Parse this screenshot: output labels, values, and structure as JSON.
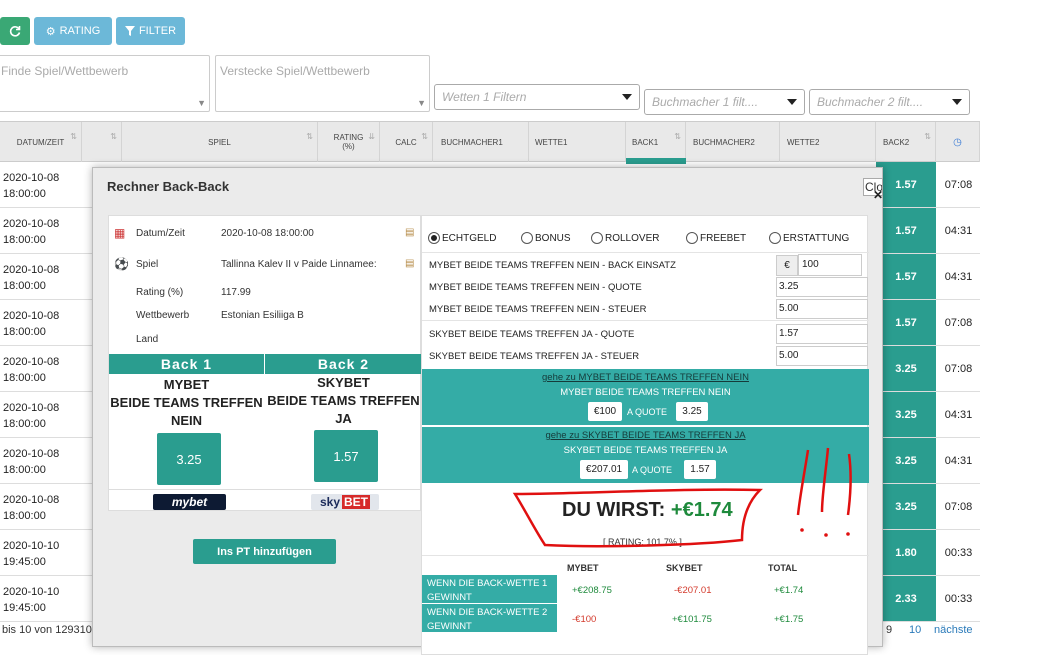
{
  "toolbar": {
    "refresh_icon": "refresh-icon",
    "rating_label": "RATING",
    "filter_label": "FILTER"
  },
  "filters": {
    "search_placeholder": "Finde Spiel/Wettbewerb",
    "hide_placeholder": "Verstecke Spiel/Wettbewerb",
    "wetten_placeholder": "Wetten 1 Filtern",
    "bm1_placeholder": "Buchmacher 1 filt....",
    "bm2_placeholder": "Buchmacher 2 filt...."
  },
  "table": {
    "headers": [
      "DATUM/ZEIT",
      "",
      "SPIEL",
      "RATING (%)",
      "CALC",
      "BUCHMACHER1",
      "WETTE1",
      "BACK1",
      "BUCHMACHER2",
      "WETTE2",
      "BACK2"
    ],
    "rows": [
      {
        "date": "2020-10-08",
        "time": "18:00:00",
        "back2": "1.57",
        "clock": "07:08"
      },
      {
        "date": "2020-10-08",
        "time": "18:00:00",
        "back2": "1.57",
        "clock": "04:31"
      },
      {
        "date": "2020-10-08",
        "time": "18:00:00",
        "back2": "1.57",
        "clock": "04:31"
      },
      {
        "date": "2020-10-08",
        "time": "18:00:00",
        "back2": "1.57",
        "clock": "07:08"
      },
      {
        "date": "2020-10-08",
        "time": "18:00:00",
        "back2": "3.25",
        "clock": "07:08"
      },
      {
        "date": "2020-10-08",
        "time": "18:00:00",
        "back2": "3.25",
        "clock": "04:31"
      },
      {
        "date": "2020-10-08",
        "time": "18:00:00",
        "back2": "3.25",
        "clock": "04:31"
      },
      {
        "date": "2020-10-08",
        "time": "18:00:00",
        "back2": "3.25",
        "clock": "07:08"
      },
      {
        "date": "2020-10-10",
        "time": "19:45:00",
        "back2": "1.80",
        "clock": "00:33"
      },
      {
        "date": "2020-10-10",
        "time": "19:45:00",
        "back2": "2.33",
        "clock": "00:33"
      }
    ],
    "footer_left": "bis 10 von 129310",
    "pager_9": "9",
    "pager_10": "10",
    "pager_next": "nächste"
  },
  "modal": {
    "title": "Rechner Back-Back",
    "close_label": "Close",
    "info": {
      "datum_label": "Datum/Zeit",
      "datum_value": "2020-10-08 18:00:00",
      "spiel_label": "Spiel",
      "spiel_value": "Tallinna Kalev II v Paide Linnamee:",
      "rating_label": "Rating (%)",
      "rating_value": "117.99",
      "wettbewerb_label": "Wettbewerb",
      "wettbewerb_value": "Estonian Esiliiga B",
      "land_label": "Land"
    },
    "back1": {
      "header": "Back 1",
      "line1": "MYBET",
      "line2": "BEIDE TEAMS TREFFEN",
      "line3": "NEIN",
      "odd": "3.25",
      "logo": "mybet"
    },
    "back2": {
      "header": "Back 2",
      "line1": "SKYBET",
      "line2": "BEIDE TEAMS TREFFEN",
      "line3": "JA",
      "odd": "1.57",
      "logo_a": "sky",
      "logo_b": "BET"
    },
    "add_pt_label": "Ins PT hinzufügen",
    "radios": [
      "ECHTGELD",
      "BONUS",
      "ROLLOVER",
      "FREEBET",
      "ERSTATTUNG"
    ],
    "fields": {
      "stake_label": "MYBET BEIDE TEAMS TREFFEN NEIN - BACK EINSATZ",
      "currency": "€",
      "stake_value": "100",
      "quote1_label": "MYBET BEIDE TEAMS TREFFEN NEIN - QUOTE",
      "quote1_value": "3.25",
      "tax1_label": "MYBET BEIDE TEAMS TREFFEN NEIN - STEUER",
      "tax1_value": "5.00",
      "quote2_label": "SKYBET BEIDE TEAMS TREFFEN JA  - QUOTE",
      "quote2_value": "1.57",
      "tax2_label": "SKYBET BEIDE TEAMS TREFFEN JA - STEUER",
      "tax2_value": "5.00"
    },
    "bet1": {
      "link": "gehe zu MYBET BEIDE TEAMS TREFFEN NEIN",
      "sub": "MYBET BEIDE TEAMS TREFFEN NEIN",
      "stake": "€100",
      "a_quote": "A QUOTE",
      "odd": "3.25"
    },
    "bet2": {
      "link": "gehe zu SKYBET BEIDE TEAMS TREFFEN JA",
      "sub": "SKYBET BEIDE TEAMS TREFFEN JA",
      "stake": "€207.01",
      "a_quote": "A QUOTE",
      "odd": "1.57"
    },
    "result": {
      "label": "DU WIRST:",
      "value": "+€1.74",
      "rating": "[ RATING: 101.7% ]"
    },
    "summary": {
      "headers": [
        "MYBET",
        "SKYBET",
        "TOTAL"
      ],
      "row1": {
        "label": "WENN DIE BACK-WETTE 1 GEWINNT",
        "mybet": "+€208.75",
        "skybet": "-€207.01",
        "total": "+€1.74"
      },
      "row2": {
        "label": "WENN DIE BACK-WETTE 2 GEWINNT",
        "mybet": "-€100",
        "skybet": "+€101.75",
        "total": "+€1.75"
      }
    }
  },
  "annotation": {
    "marks": "!!!"
  },
  "colors": {
    "teal": "#2a9d8f",
    "accent_blue": "#6cb8d8",
    "green_btn": "#3aa875",
    "positive": "#1e8a3c",
    "negative": "#d33a2c",
    "annotation_red": "#e01010"
  }
}
